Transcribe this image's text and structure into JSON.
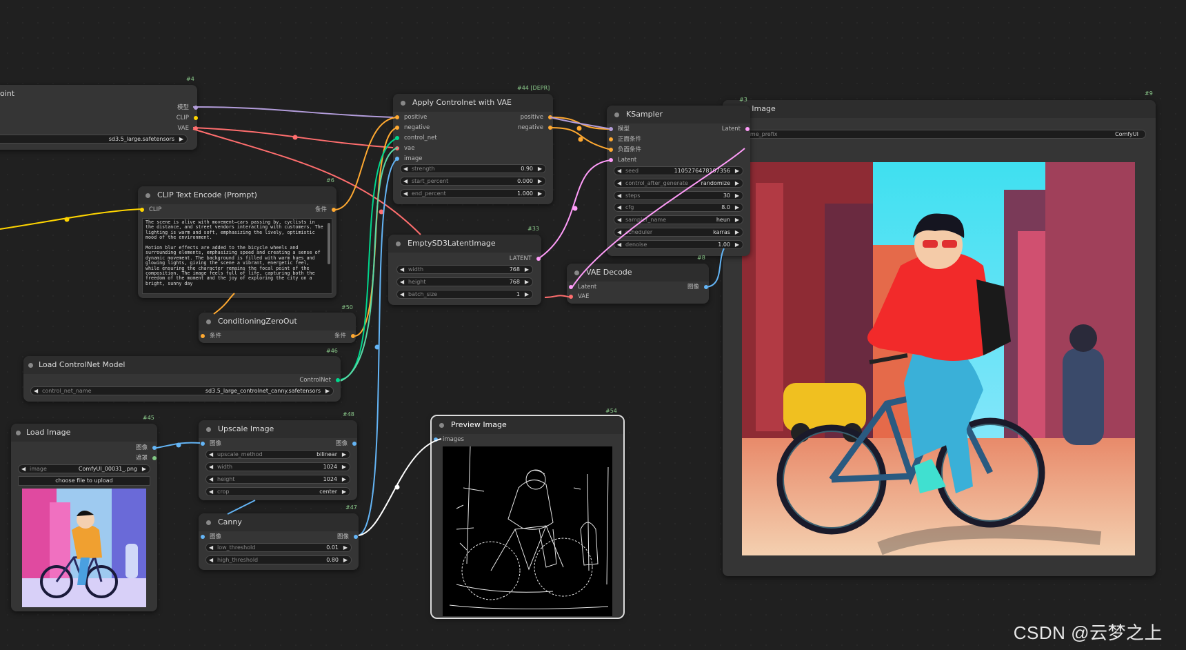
{
  "colors": {
    "model": "#b39ddb",
    "clip": "#ffd500",
    "vae": "#ff6e6e",
    "conditioning": "#ffa931",
    "latent": "#ff9cf9",
    "image": "#64b5f6",
    "control_net": "#00d78d",
    "mask": "#81c784"
  },
  "nodes": {
    "checkpoint": {
      "id": "#4",
      "title": "oint",
      "outputs": [
        "模型",
        "CLIP",
        "VAE"
      ],
      "widget_value": "sd3.5_large.safetensors"
    },
    "apply_controlnet": {
      "id": "#44 [DEPR]",
      "title": "Apply Controlnet with VAE",
      "inputs": [
        "positive",
        "negative",
        "control_net",
        "vae",
        "image"
      ],
      "outputs": [
        "positive",
        "negative"
      ],
      "widgets": [
        {
          "label": "strength",
          "value": "0.90"
        },
        {
          "label": "start_percent",
          "value": "0.000"
        },
        {
          "label": "end_percent",
          "value": "1.000"
        }
      ]
    },
    "ksampler": {
      "id": "#3",
      "title": "KSampler",
      "inputs": [
        "模型",
        "正面条件",
        "负面条件",
        "Latent"
      ],
      "output": "Latent",
      "widgets": [
        {
          "label": "seed",
          "value": "1105276478107356"
        },
        {
          "label": "control_after_generate",
          "value": "randomize"
        },
        {
          "label": "steps",
          "value": "30"
        },
        {
          "label": "cfg",
          "value": "8.0"
        },
        {
          "label": "sampler_name",
          "value": "heun"
        },
        {
          "label": "scheduler",
          "value": "karras"
        },
        {
          "label": "denoise",
          "value": "1.00"
        }
      ]
    },
    "save_image": {
      "id": "#9",
      "title": "e Image",
      "widget_label": "ame_prefix",
      "widget_value": "ComfyUI"
    },
    "clip_text": {
      "id": "#6",
      "title": "CLIP Text Encode (Prompt)",
      "input": "CLIP",
      "output": "条件",
      "text": "The scene is alive with movement—cars passing by, cyclists in the distance, and street vendors interacting with customers. The lighting is warm and soft, emphasizing the lively, optimistic mood of the environment.\n\nMotion blur effects are added to the bicycle wheels and surrounding elements, emphasizing speed and creating a sense of dynamic movement. The background is filled with warm hues and glowing lights, giving the scene a vibrant, energetic feel, while ensuring the character remains the focal point of the composition. The image feels full of life, capturing both the freedom of the moment and the joy of exploring the city on a bright, sunny day"
    },
    "empty_latent": {
      "id": "#33",
      "title": "EmptySD3LatentImage",
      "output": "LATENT",
      "widgets": [
        {
          "label": "width",
          "value": "768"
        },
        {
          "label": "height",
          "value": "768"
        },
        {
          "label": "batch_size",
          "value": "1"
        }
      ]
    },
    "vae_decode": {
      "id": "#8",
      "title": "VAE Decode",
      "inputs": [
        "Latent",
        "VAE"
      ],
      "output": "图像"
    },
    "cond_zero": {
      "id": "#50",
      "title": "ConditioningZeroOut",
      "input": "条件",
      "output": "条件"
    },
    "load_controlnet": {
      "id": "#46",
      "title": "Load ControlNet Model",
      "output": "ControlNet",
      "widget_label": "control_net_name",
      "widget_value": "sd3.5_large_controlnet_canny.safetensors"
    },
    "load_image": {
      "id": "#45",
      "title": "Load Image",
      "outputs": [
        "图像",
        "遮罩"
      ],
      "widget_label": "image",
      "widget_value": "ComfyUI_00031_.png",
      "button": "choose file to upload"
    },
    "upscale": {
      "id": "#48",
      "title": "Upscale Image",
      "input": "图像",
      "output": "图像",
      "widgets": [
        {
          "label": "upscale_method",
          "value": "bilinear"
        },
        {
          "label": "width",
          "value": "1024"
        },
        {
          "label": "height",
          "value": "1024"
        },
        {
          "label": "crop",
          "value": "center"
        }
      ]
    },
    "canny": {
      "id": "#47",
      "title": "Canny",
      "input": "图像",
      "output": "图像",
      "widgets": [
        {
          "label": "low_threshold",
          "value": "0.01"
        },
        {
          "label": "high_threshold",
          "value": "0.80"
        }
      ]
    },
    "preview": {
      "id": "#54",
      "title": "Preview Image",
      "input": "images"
    }
  },
  "watermark": "CSDN @云梦之上"
}
